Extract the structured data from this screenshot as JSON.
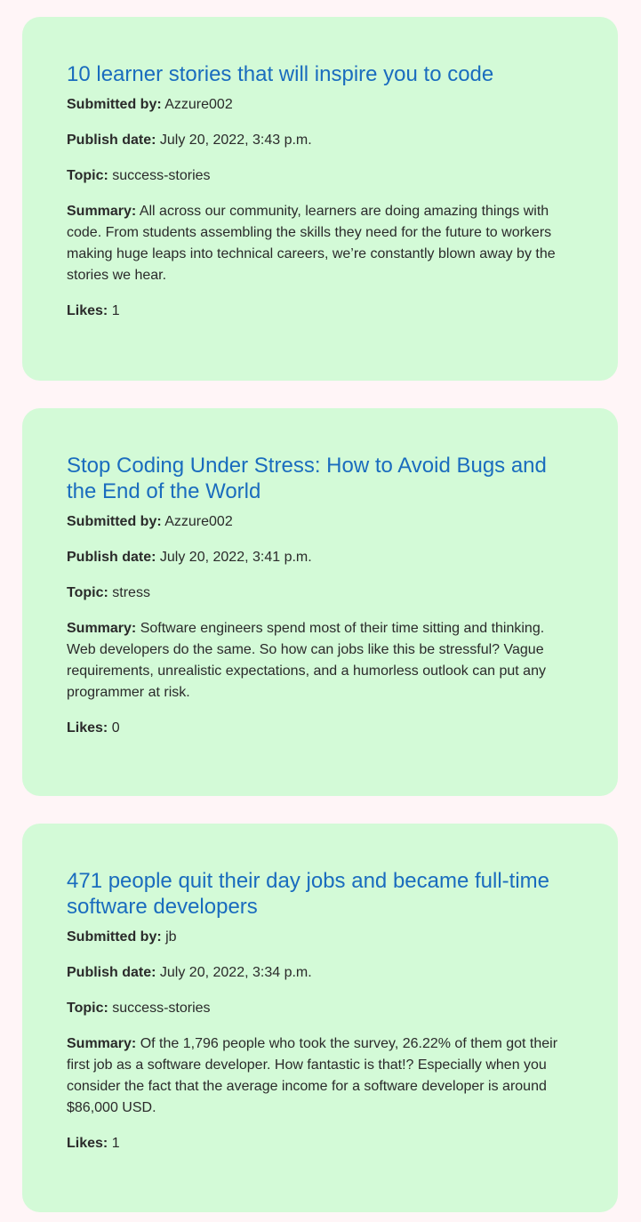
{
  "labels": {
    "submitted_by": "Submitted by:",
    "publish_date": "Publish date:",
    "topic": "Topic:",
    "summary": "Summary:",
    "likes": "Likes:"
  },
  "colors": {
    "page_background": "#fff5f7",
    "card_background": "#d3fad7",
    "title_link": "#1a6cbe",
    "text": "#2a2a2a"
  },
  "posts": [
    {
      "title": "10 learner stories that will inspire you to code",
      "submitted_by": "Azzure002",
      "publish_date": "July 20, 2022, 3:43 p.m.",
      "topic": "success-stories",
      "summary": "All across our community, learners are doing amazing things with code. From students assembling the skills they need for the future to workers making huge leaps into technical careers, we’re constantly blown away by the stories we hear.",
      "likes": "1"
    },
    {
      "title": "Stop Coding Under Stress: How to Avoid Bugs and the End of the World",
      "submitted_by": "Azzure002",
      "publish_date": "July 20, 2022, 3:41 p.m.",
      "topic": "stress",
      "summary": "Software engineers spend most of their time sitting and thinking. Web developers do the same. So how can jobs like this be stressful? Vague requirements, unrealistic expectations, and a humorless outlook can put any programmer at risk.",
      "likes": "0"
    },
    {
      "title": "471 people quit their day jobs and became full-time software developers",
      "submitted_by": "jb",
      "publish_date": "July 20, 2022, 3:34 p.m.",
      "topic": "success-stories",
      "summary": "Of the 1,796 people who took the survey, 26.22% of them got their first job as a software developer. How fantastic is that!? Especially when you consider the fact that the average income for a software developer is around $86,000 USD.",
      "likes": "1"
    }
  ]
}
